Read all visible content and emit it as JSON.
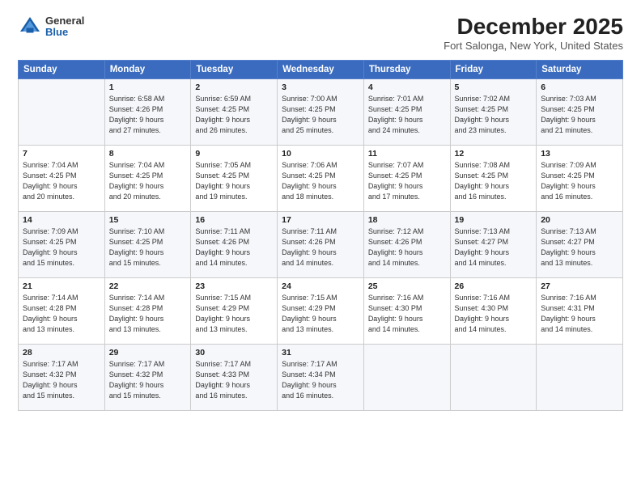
{
  "logo": {
    "general": "General",
    "blue": "Blue"
  },
  "title": "December 2025",
  "subtitle": "Fort Salonga, New York, United States",
  "headers": [
    "Sunday",
    "Monday",
    "Tuesday",
    "Wednesday",
    "Thursday",
    "Friday",
    "Saturday"
  ],
  "weeks": [
    [
      {
        "num": "",
        "info": ""
      },
      {
        "num": "1",
        "info": "Sunrise: 6:58 AM\nSunset: 4:26 PM\nDaylight: 9 hours\nand 27 minutes."
      },
      {
        "num": "2",
        "info": "Sunrise: 6:59 AM\nSunset: 4:25 PM\nDaylight: 9 hours\nand 26 minutes."
      },
      {
        "num": "3",
        "info": "Sunrise: 7:00 AM\nSunset: 4:25 PM\nDaylight: 9 hours\nand 25 minutes."
      },
      {
        "num": "4",
        "info": "Sunrise: 7:01 AM\nSunset: 4:25 PM\nDaylight: 9 hours\nand 24 minutes."
      },
      {
        "num": "5",
        "info": "Sunrise: 7:02 AM\nSunset: 4:25 PM\nDaylight: 9 hours\nand 23 minutes."
      },
      {
        "num": "6",
        "info": "Sunrise: 7:03 AM\nSunset: 4:25 PM\nDaylight: 9 hours\nand 21 minutes."
      }
    ],
    [
      {
        "num": "7",
        "info": "Sunrise: 7:04 AM\nSunset: 4:25 PM\nDaylight: 9 hours\nand 20 minutes."
      },
      {
        "num": "8",
        "info": "Sunrise: 7:04 AM\nSunset: 4:25 PM\nDaylight: 9 hours\nand 20 minutes."
      },
      {
        "num": "9",
        "info": "Sunrise: 7:05 AM\nSunset: 4:25 PM\nDaylight: 9 hours\nand 19 minutes."
      },
      {
        "num": "10",
        "info": "Sunrise: 7:06 AM\nSunset: 4:25 PM\nDaylight: 9 hours\nand 18 minutes."
      },
      {
        "num": "11",
        "info": "Sunrise: 7:07 AM\nSunset: 4:25 PM\nDaylight: 9 hours\nand 17 minutes."
      },
      {
        "num": "12",
        "info": "Sunrise: 7:08 AM\nSunset: 4:25 PM\nDaylight: 9 hours\nand 16 minutes."
      },
      {
        "num": "13",
        "info": "Sunrise: 7:09 AM\nSunset: 4:25 PM\nDaylight: 9 hours\nand 16 minutes."
      }
    ],
    [
      {
        "num": "14",
        "info": "Sunrise: 7:09 AM\nSunset: 4:25 PM\nDaylight: 9 hours\nand 15 minutes."
      },
      {
        "num": "15",
        "info": "Sunrise: 7:10 AM\nSunset: 4:25 PM\nDaylight: 9 hours\nand 15 minutes."
      },
      {
        "num": "16",
        "info": "Sunrise: 7:11 AM\nSunset: 4:26 PM\nDaylight: 9 hours\nand 14 minutes."
      },
      {
        "num": "17",
        "info": "Sunrise: 7:11 AM\nSunset: 4:26 PM\nDaylight: 9 hours\nand 14 minutes."
      },
      {
        "num": "18",
        "info": "Sunrise: 7:12 AM\nSunset: 4:26 PM\nDaylight: 9 hours\nand 14 minutes."
      },
      {
        "num": "19",
        "info": "Sunrise: 7:13 AM\nSunset: 4:27 PM\nDaylight: 9 hours\nand 14 minutes."
      },
      {
        "num": "20",
        "info": "Sunrise: 7:13 AM\nSunset: 4:27 PM\nDaylight: 9 hours\nand 13 minutes."
      }
    ],
    [
      {
        "num": "21",
        "info": "Sunrise: 7:14 AM\nSunset: 4:28 PM\nDaylight: 9 hours\nand 13 minutes."
      },
      {
        "num": "22",
        "info": "Sunrise: 7:14 AM\nSunset: 4:28 PM\nDaylight: 9 hours\nand 13 minutes."
      },
      {
        "num": "23",
        "info": "Sunrise: 7:15 AM\nSunset: 4:29 PM\nDaylight: 9 hours\nand 13 minutes."
      },
      {
        "num": "24",
        "info": "Sunrise: 7:15 AM\nSunset: 4:29 PM\nDaylight: 9 hours\nand 13 minutes."
      },
      {
        "num": "25",
        "info": "Sunrise: 7:16 AM\nSunset: 4:30 PM\nDaylight: 9 hours\nand 14 minutes."
      },
      {
        "num": "26",
        "info": "Sunrise: 7:16 AM\nSunset: 4:30 PM\nDaylight: 9 hours\nand 14 minutes."
      },
      {
        "num": "27",
        "info": "Sunrise: 7:16 AM\nSunset: 4:31 PM\nDaylight: 9 hours\nand 14 minutes."
      }
    ],
    [
      {
        "num": "28",
        "info": "Sunrise: 7:17 AM\nSunset: 4:32 PM\nDaylight: 9 hours\nand 15 minutes."
      },
      {
        "num": "29",
        "info": "Sunrise: 7:17 AM\nSunset: 4:32 PM\nDaylight: 9 hours\nand 15 minutes."
      },
      {
        "num": "30",
        "info": "Sunrise: 7:17 AM\nSunset: 4:33 PM\nDaylight: 9 hours\nand 16 minutes."
      },
      {
        "num": "31",
        "info": "Sunrise: 7:17 AM\nSunset: 4:34 PM\nDaylight: 9 hours\nand 16 minutes."
      },
      {
        "num": "",
        "info": ""
      },
      {
        "num": "",
        "info": ""
      },
      {
        "num": "",
        "info": ""
      }
    ]
  ]
}
